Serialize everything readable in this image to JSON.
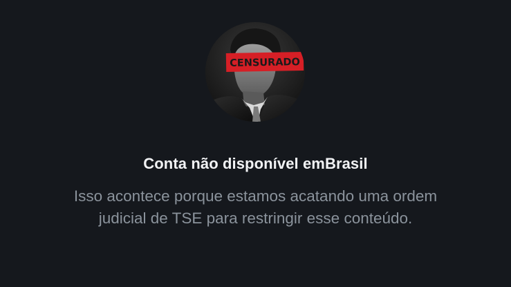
{
  "profile": {
    "avatar_icon": "censored-portrait-icon",
    "censor_label": "CENSURADO",
    "censor_color": "#d61f26"
  },
  "notice": {
    "title": "Conta não disponível emBrasil",
    "message": "Isso acontece porque estamos acatando uma ordem judicial de TSE para restringir esse conteúdo."
  },
  "colors": {
    "background": "#15181d",
    "title": "#f2f3f5",
    "message": "#8b939c"
  }
}
